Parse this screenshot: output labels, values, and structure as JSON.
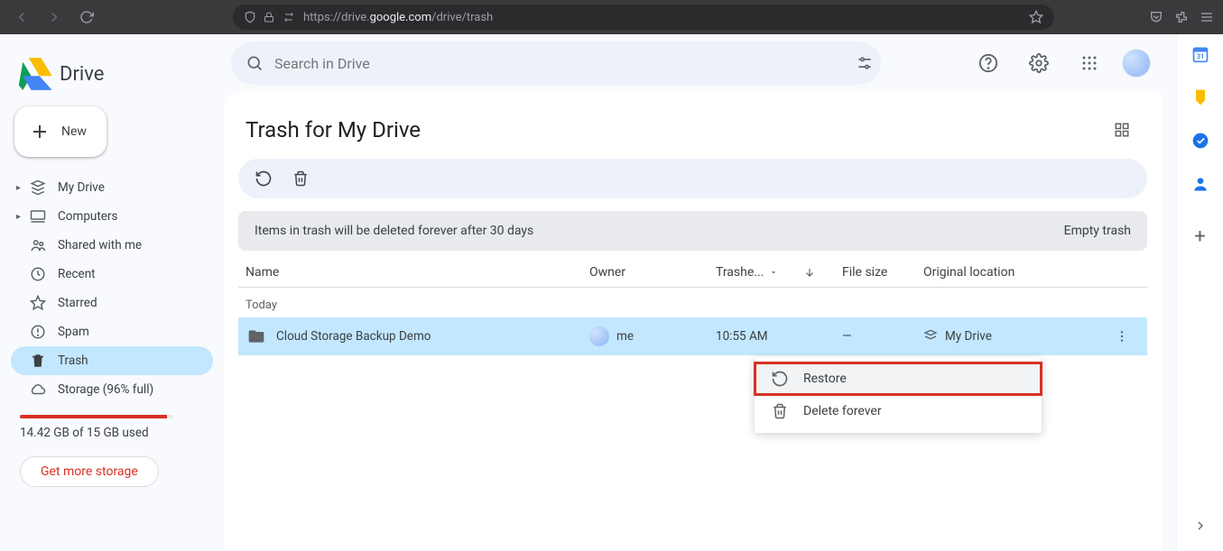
{
  "browser": {
    "url_prefix": "https://drive.",
    "url_host": "google.com",
    "url_path": "/drive/trash"
  },
  "brand": {
    "name": "Drive"
  },
  "new_button": "New",
  "sidebar": {
    "items": [
      {
        "label": "My Drive"
      },
      {
        "label": "Computers"
      },
      {
        "label": "Shared with me"
      },
      {
        "label": "Recent"
      },
      {
        "label": "Starred"
      },
      {
        "label": "Spam"
      },
      {
        "label": "Trash"
      },
      {
        "label": "Storage (96% full)"
      }
    ],
    "storage_text": "14.42 GB of 15 GB used",
    "get_more": "Get more storage"
  },
  "search": {
    "placeholder": "Search in Drive"
  },
  "page": {
    "title": "Trash for My Drive",
    "notice": "Items in trash will be deleted forever after 30 days",
    "empty_trash": "Empty trash"
  },
  "columns": {
    "name": "Name",
    "owner": "Owner",
    "trashed": "Trashe...",
    "size": "File size",
    "location": "Original location"
  },
  "group": {
    "today": "Today"
  },
  "rows": [
    {
      "name": "Cloud Storage Backup Demo",
      "owner": "me",
      "trashed": "10:55 AM",
      "size": "—",
      "location": "My Drive"
    }
  ],
  "context_menu": {
    "restore": "Restore",
    "delete_forever": "Delete forever"
  }
}
